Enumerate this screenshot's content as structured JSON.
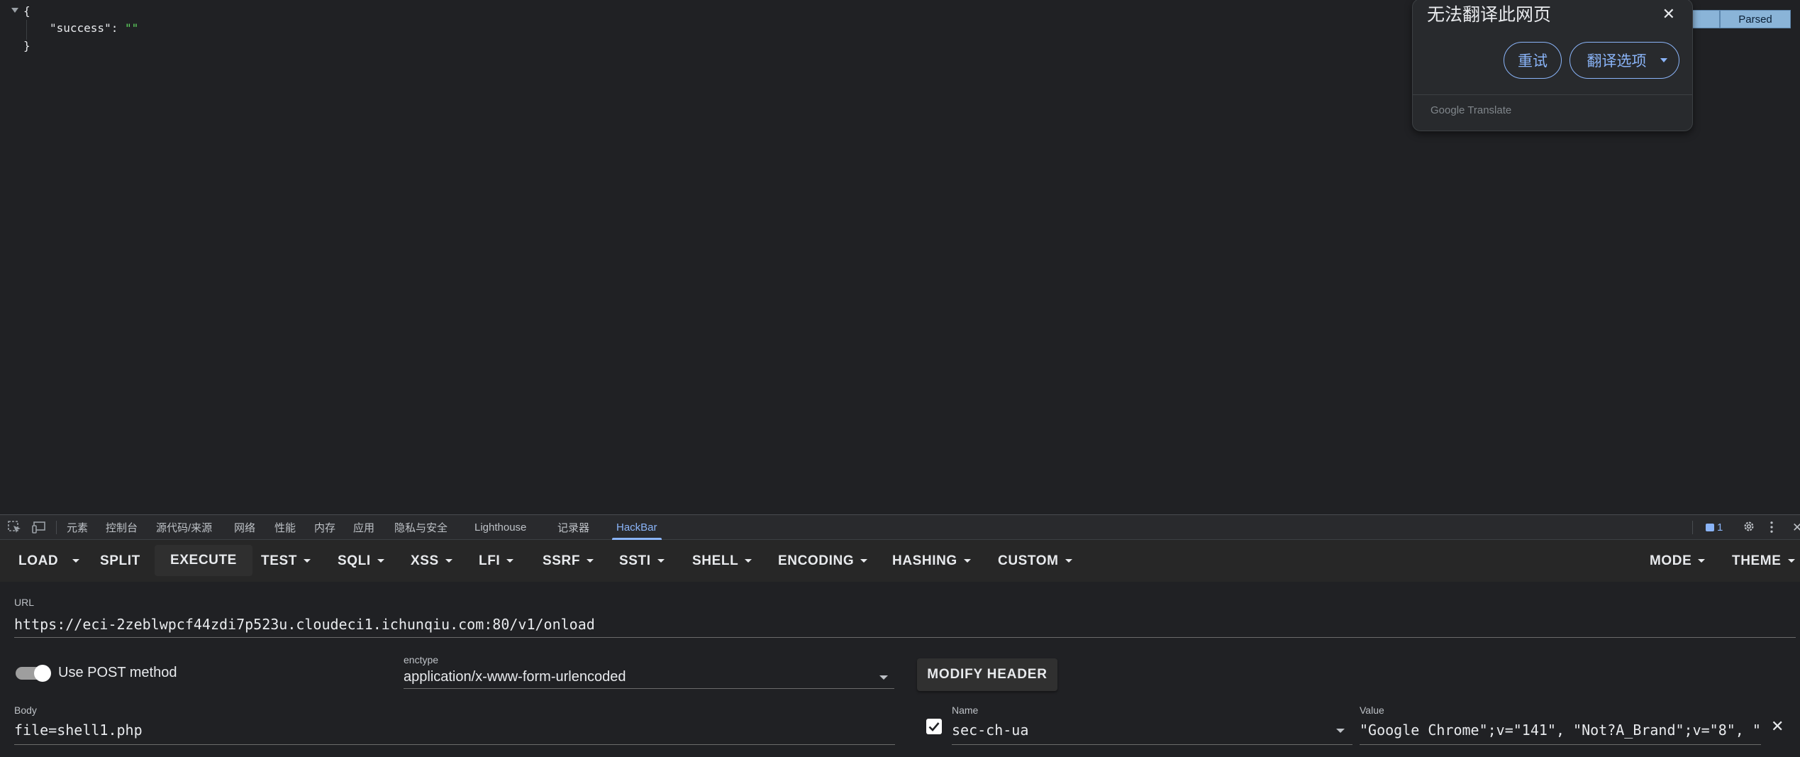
{
  "json_view": {
    "open_brace": "{",
    "key": "\"success\"",
    "colon": ": ",
    "value": "\"\"",
    "close_brace": "}"
  },
  "viewer_tabs": {
    "parsed": "Parsed"
  },
  "translate_popup": {
    "title": "无法翻译此网页",
    "close_symbol": "✕",
    "retry_label": "重试",
    "options_label": "翻译选项",
    "brand": "Google Translate"
  },
  "devtools": {
    "tabs": [
      "元素",
      "控制台",
      "源代码/来源",
      "网络",
      "性能",
      "内存",
      "应用",
      "隐私与安全",
      "Lighthouse",
      "记录器",
      "HackBar"
    ],
    "active_tab": "HackBar",
    "issues_count": "1",
    "close_symbol": "✕"
  },
  "hackbar": {
    "toolbar": {
      "load": "LOAD",
      "split": "SPLIT",
      "execute": "EXECUTE",
      "test": "TEST",
      "sqli": "SQLI",
      "xss": "XSS",
      "lfi": "LFI",
      "ssrf": "SSRF",
      "ssti": "SSTI",
      "shell": "SHELL",
      "encoding": "ENCODING",
      "hashing": "HASHING",
      "custom": "CUSTOM",
      "mode": "MODE",
      "theme": "THEME"
    },
    "url_label": "URL",
    "url_value": "https://eci-2zeblwpcf44zdi7p523u.cloudeci1.ichunqiu.com:80/v1/onload",
    "post_toggle_label": "Use POST method",
    "post_enabled": true,
    "enctype_label": "enctype",
    "enctype_value": "application/x-www-form-urlencoded",
    "modify_header_label": "MODIFY HEADER",
    "body_label": "Body",
    "body_value": "file=shell1.php",
    "header": {
      "enabled": true,
      "name_label": "Name",
      "name_value": "sec-ch-ua",
      "value_label": "Value",
      "value_value": "\"Google Chrome\";v=\"141\", \"Not?A_Brand\";v=\"8\", \"",
      "remove_symbol": "✕"
    }
  },
  "colors": {
    "background": "#202124",
    "accent": "#8ab4f8",
    "json_string": "#5fd75f"
  }
}
